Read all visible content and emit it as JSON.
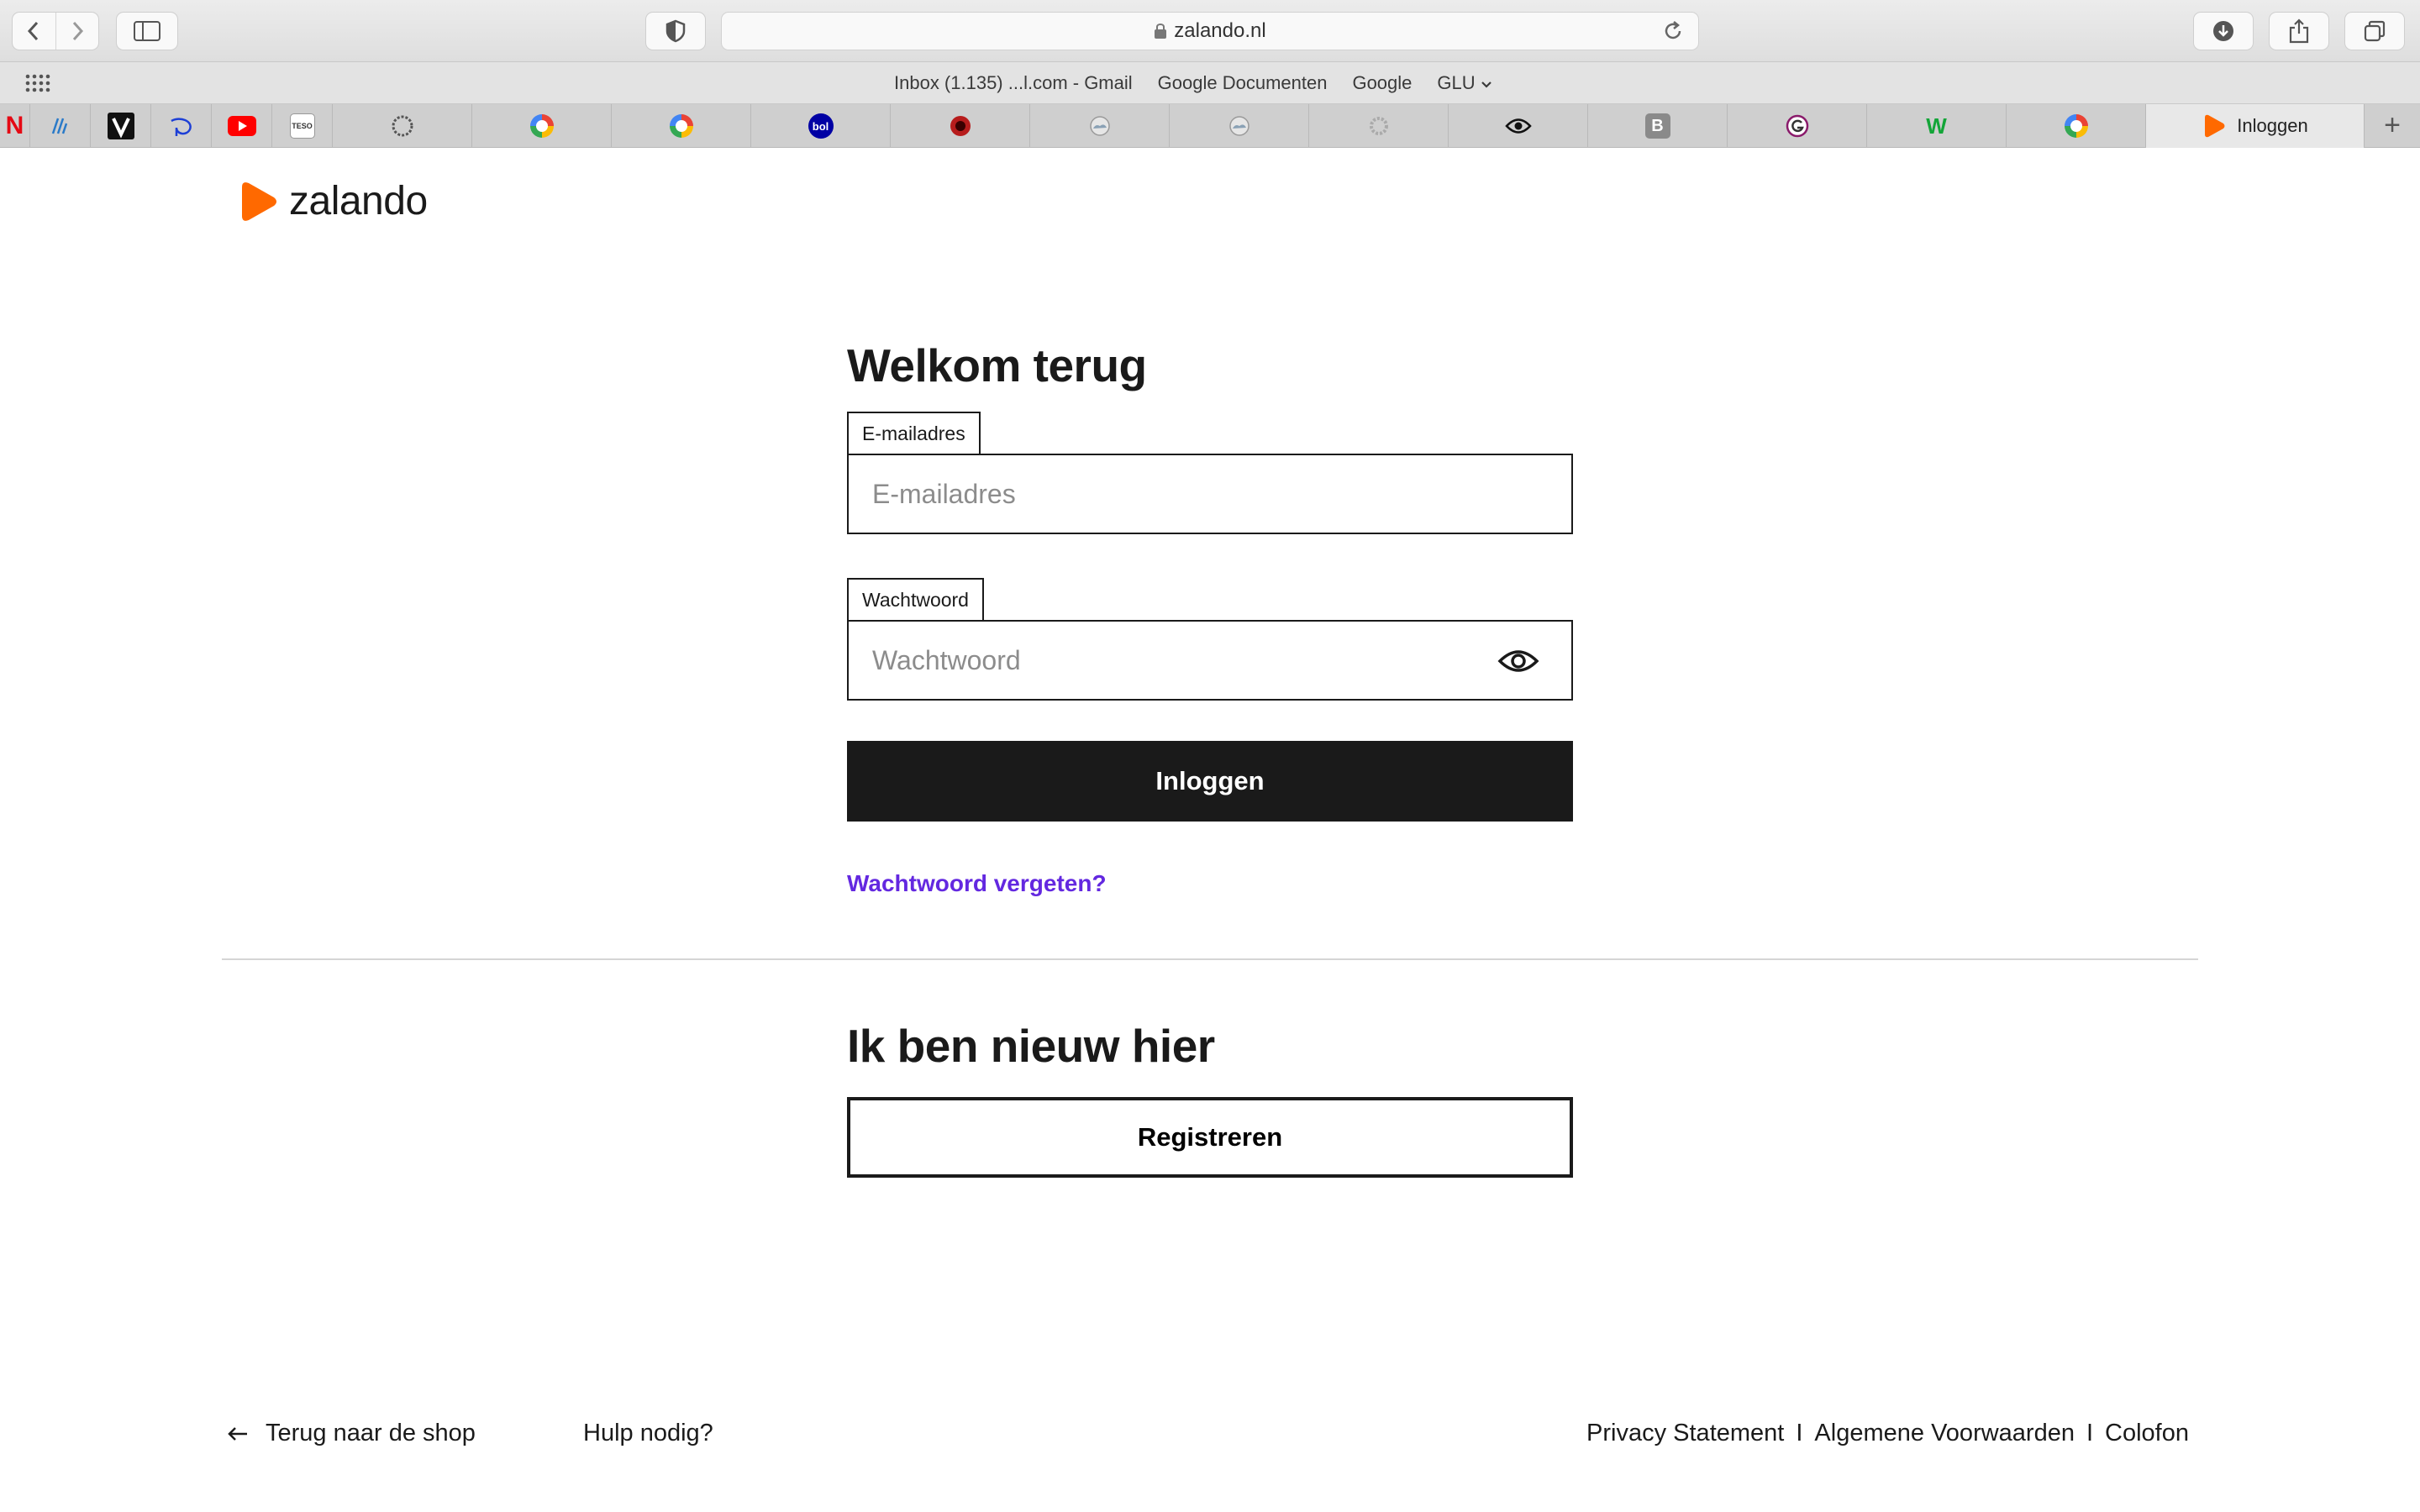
{
  "browser": {
    "url": "zalando.nl",
    "favorites": [
      "Inbox (1.135) ...l.com - Gmail",
      "Google Documenten",
      "Google",
      "GLU"
    ],
    "pinned_tabs": [
      "N",
      "B",
      "bol",
      "W",
      "TESO"
    ],
    "active_tab_title": "Inloggen"
  },
  "brand": {
    "name": "zalando",
    "accent_color": "#ff6900"
  },
  "login": {
    "title": "Welkom terug",
    "email_label": "E-mailadres",
    "email_placeholder": "E-mailadres",
    "email_value": "",
    "password_label": "Wachtwoord",
    "password_placeholder": "Wachtwoord",
    "password_value": "",
    "submit_label": "Inloggen",
    "forgot_label": "Wachtwoord vergeten?",
    "link_color": "#6328e0"
  },
  "register": {
    "title": "Ik ben nieuw hier",
    "button_label": "Registreren"
  },
  "footer": {
    "back_label": "Terug naar de shop",
    "help_label": "Hulp nodig?",
    "privacy_label": "Privacy Statement",
    "terms_label": "Algemene Voorwaarden",
    "colofon_label": "Colofon",
    "separator": "I"
  }
}
